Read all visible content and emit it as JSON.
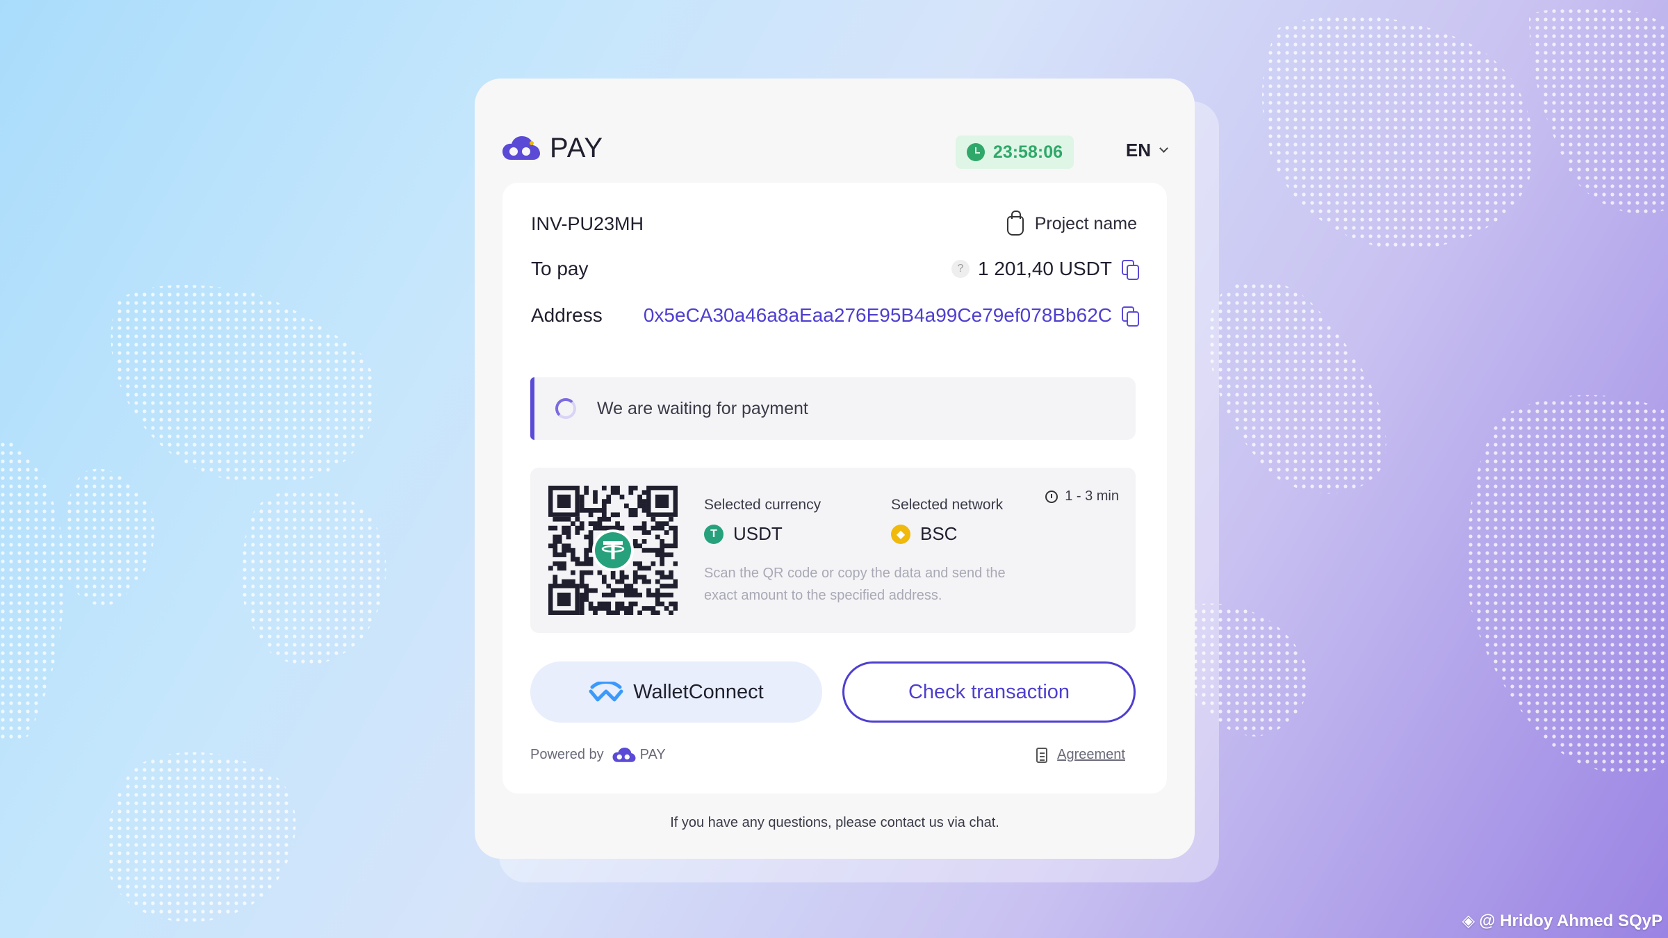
{
  "header": {
    "logo_text": "PAY",
    "timer": "23:58:06",
    "language": "EN"
  },
  "invoice": {
    "id": "INV-PU23MH",
    "project_name": "Project name",
    "to_pay_label": "To pay",
    "amount": "1 201,40 USDT",
    "address_label": "Address",
    "address": "0x5eCA30a46a8aEaa276E95B4a99Ce79ef078Bb62C"
  },
  "status": {
    "text": "We are waiting for payment"
  },
  "payment": {
    "currency_label": "Selected currency",
    "currency": "USDT",
    "network_label": "Selected network",
    "network": "BSC",
    "eta": "1 - 3 min",
    "hint": "Scan the QR code or copy the data and send the exact amount to the specified address."
  },
  "actions": {
    "walletconnect": "WalletConnect",
    "check": "Check transaction"
  },
  "footer": {
    "powered_by": "Powered by",
    "powered_logo": "PAY",
    "agreement": "Agreement",
    "contact": "If you have any questions, please contact us via chat."
  },
  "watermark": "@ Hridoy Ahmed SQyP",
  "colors": {
    "accent": "#4e3fcf",
    "timer_green": "#2fa86a",
    "usdt": "#26a17b",
    "bsc": "#f0b90b"
  }
}
